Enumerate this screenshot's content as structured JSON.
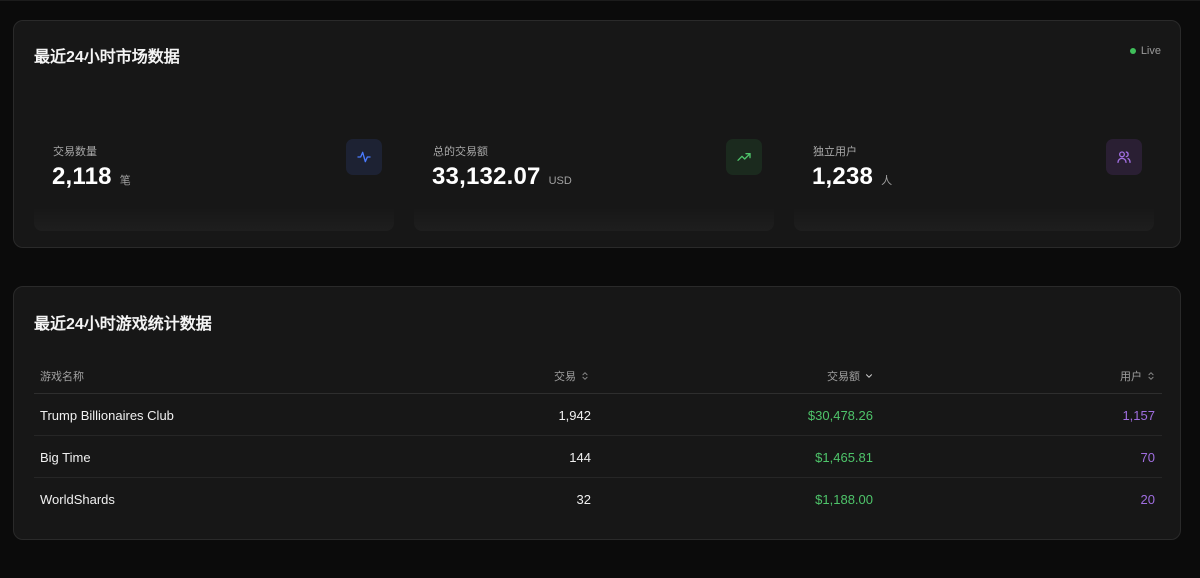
{
  "market": {
    "title": "最近24小时市场数据",
    "live_label": "Live",
    "stats": [
      {
        "label": "交易数量",
        "value": "2,118",
        "unit": "笔",
        "icon": "activity-icon"
      },
      {
        "label": "总的交易额",
        "value": "33,132.07",
        "unit": "USD",
        "icon": "trending-up-icon"
      },
      {
        "label": "独立用户",
        "value": "1,238",
        "unit": "人",
        "icon": "users-icon"
      }
    ]
  },
  "games": {
    "title": "最近24小时游戏统计数据",
    "columns": {
      "name": "游戏名称",
      "transactions": "交易",
      "volume": "交易额",
      "users": "用户"
    },
    "rows": [
      {
        "name": "Trump Billionaires Club",
        "transactions": "1,942",
        "volume": "$30,478.26",
        "users": "1,157"
      },
      {
        "name": "Big Time",
        "transactions": "144",
        "volume": "$1,465.81",
        "users": "70"
      },
      {
        "name": "WorldShards",
        "transactions": "32",
        "volume": "$1,188.00",
        "users": "20"
      }
    ]
  },
  "colors": {
    "accent_blue": "#4a7bff",
    "accent_green": "#4ec46a",
    "accent_purple": "#a06ee0",
    "live_dot": "#3fbf5a"
  }
}
